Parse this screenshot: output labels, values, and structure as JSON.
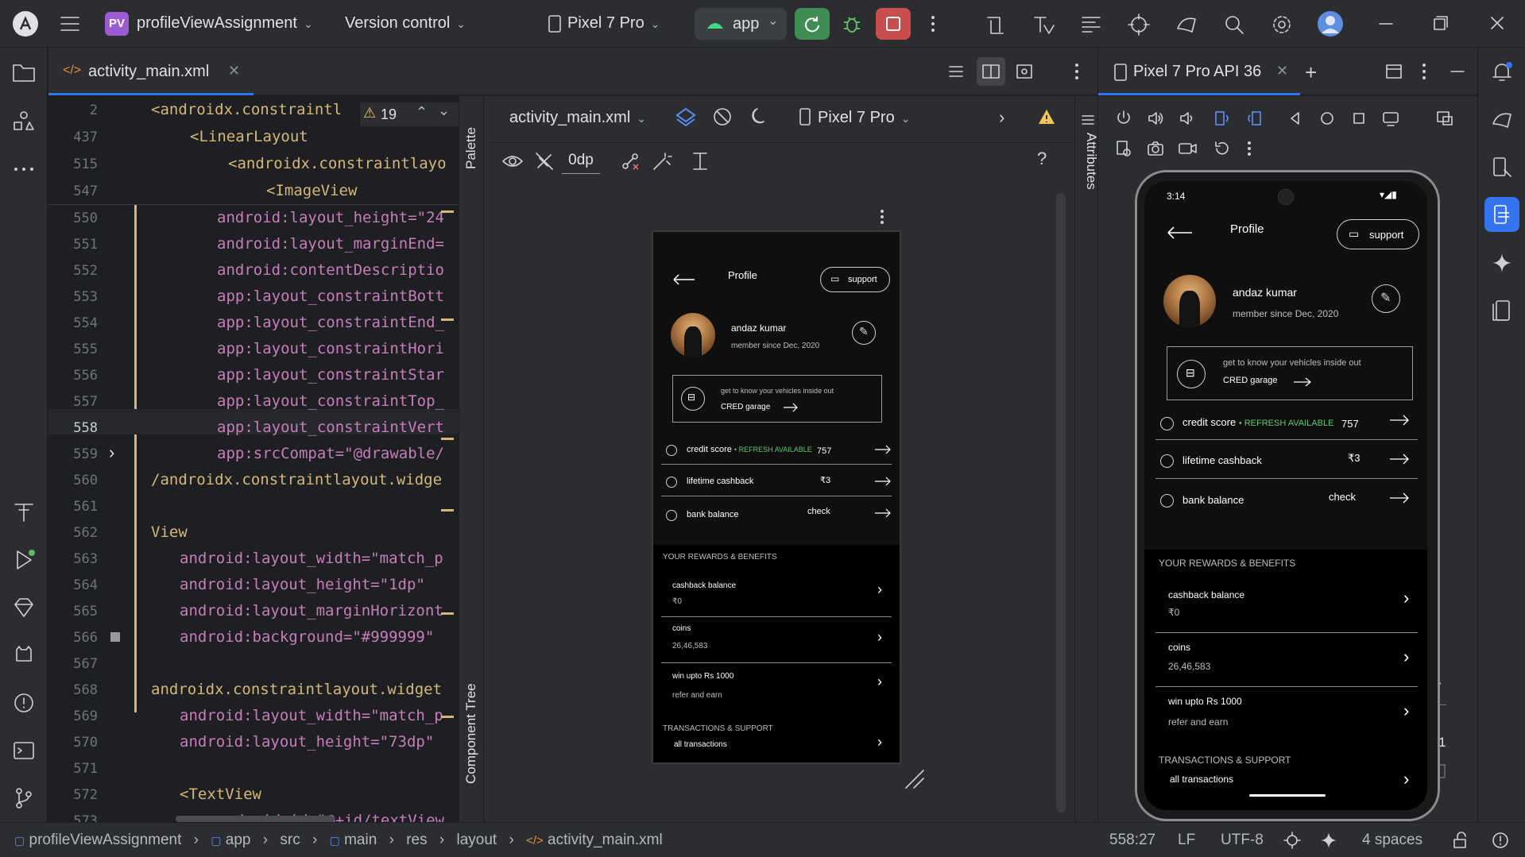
{
  "topbar": {
    "project_badge": "PV",
    "project_name": "profileViewAssignment",
    "vcs_label": "Version control",
    "device_label": "Pixel 7 Pro",
    "run_config": "app"
  },
  "editor": {
    "tab_label": "activity_main.xml",
    "warning_count": "19",
    "lines": [
      {
        "n": "2",
        "text": "<androidx.constraintl"
      },
      {
        "n": "437",
        "text": "<LinearLayout"
      },
      {
        "n": "515",
        "text": "<androidx.constraintlayo"
      },
      {
        "n": "547",
        "text": "<ImageView"
      },
      {
        "n": "550",
        "text": "android:layout_height=\"24"
      },
      {
        "n": "551",
        "text": "android:layout_marginEnd="
      },
      {
        "n": "552",
        "text": "android:contentDescriptio"
      },
      {
        "n": "553",
        "text": "app:layout_constraintBott"
      },
      {
        "n": "554",
        "text": "app:layout_constraintEnd_"
      },
      {
        "n": "555",
        "text": "app:layout_constraintHori"
      },
      {
        "n": "556",
        "text": "app:layout_constraintStar"
      },
      {
        "n": "557",
        "text": "app:layout_constraintTop_"
      },
      {
        "n": "558",
        "text": "app:layout_constraintVert"
      },
      {
        "n": "559",
        "text": "app:srcCompat=\"@drawable/"
      },
      {
        "n": "560",
        "text": "/androidx.constraintlayout.widge"
      },
      {
        "n": "561",
        "text": ""
      },
      {
        "n": "562",
        "text": "View"
      },
      {
        "n": "563",
        "text": "android:layout_width=\"match_p"
      },
      {
        "n": "564",
        "text": "android:layout_height=\"1dp\""
      },
      {
        "n": "565",
        "text": "android:layout_marginHorizont"
      },
      {
        "n": "566",
        "text": "android:background=\"#999999\""
      },
      {
        "n": "567",
        "text": ""
      },
      {
        "n": "568",
        "text": "androidx.constraintlayout.widget"
      },
      {
        "n": "569",
        "text": "android:layout_width=\"match_p"
      },
      {
        "n": "570",
        "text": "android:layout_height=\"73dp\""
      },
      {
        "n": "571",
        "text": ""
      },
      {
        "n": "572",
        "text": "<TextView"
      },
      {
        "n": "573",
        "text": "android:id=\"@+id/textView"
      }
    ]
  },
  "design": {
    "palette_label": "Palette",
    "component_tree_label": "Component Tree",
    "attributes_label": "Attributes",
    "file_label": "activity_main.xml",
    "device_label": "Pixel 7 Pro",
    "dp_value": "0dp",
    "help": "?"
  },
  "emulator": {
    "tab_label": "Pixel 7 Pro API 36",
    "zoom_label": "1:1"
  },
  "app": {
    "clock": "3:14",
    "title": "Profile",
    "support": "support",
    "user_name": "andaz kumar",
    "member_since": "member since Dec, 2020",
    "garage_caption": "get to know your vehicles inside out",
    "garage_link": "CRED garage",
    "credit_score_label": "credit score",
    "refresh_label": "• REFRESH AVAILABLE",
    "credit_score_value": "757",
    "cashback_label": "lifetime cashback",
    "cashback_value": "₹3",
    "bank_label": "bank balance",
    "bank_value": "check",
    "rewards_header": "YOUR REWARDS & BENEFITS",
    "cashback_balance_label": "cashback balance",
    "cashback_balance_value": "₹0",
    "coins_label": "coins",
    "coins_value": "26,46,583",
    "win_label": "win upto Rs 1000",
    "win_sub": "refer and earn",
    "transactions_header": "TRANSACTIONS & SUPPORT",
    "all_transactions": "all transactions"
  },
  "statusbar": {
    "crumbs": [
      "profileViewAssignment",
      "app",
      "src",
      "main",
      "res",
      "layout",
      "activity_main.xml"
    ],
    "position": "558:27",
    "line_sep": "LF",
    "encoding": "UTF-8",
    "indent": "4 spaces"
  },
  "colors": {
    "accent": "#3574f0",
    "run_green": "#3f8d53",
    "stop_red": "#c94f4f",
    "refresh_green": "#5ec86b"
  }
}
